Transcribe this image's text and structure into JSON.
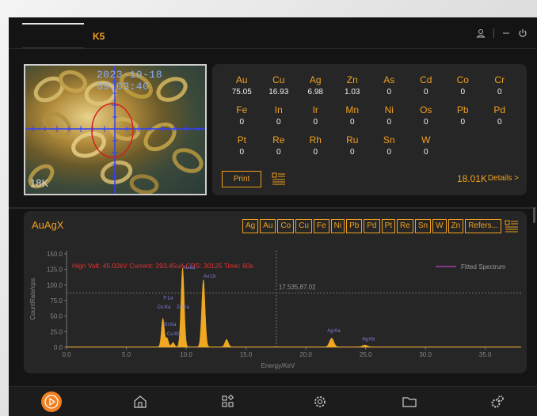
{
  "header": {
    "device_name": "K5",
    "icons": [
      "user-icon",
      "minimize-icon",
      "power-icon"
    ]
  },
  "camera": {
    "timestamp": "2023-10-18 09:03:40",
    "zoom_label": "18K"
  },
  "elements": [
    {
      "symbol": "Au",
      "value": "75.05"
    },
    {
      "symbol": "Cu",
      "value": "16.93"
    },
    {
      "symbol": "Ag",
      "value": "6.98"
    },
    {
      "symbol": "Zn",
      "value": "1.03"
    },
    {
      "symbol": "As",
      "value": "0"
    },
    {
      "symbol": "Cd",
      "value": "0"
    },
    {
      "symbol": "Co",
      "value": "0"
    },
    {
      "symbol": "Cr",
      "value": "0"
    },
    {
      "symbol": "Fe",
      "value": "0"
    },
    {
      "symbol": "In",
      "value": "0"
    },
    {
      "symbol": "Ir",
      "value": "0"
    },
    {
      "symbol": "Mn",
      "value": "0"
    },
    {
      "symbol": "Ni",
      "value": "0"
    },
    {
      "symbol": "Os",
      "value": "0"
    },
    {
      "symbol": "Pb",
      "value": "0"
    },
    {
      "symbol": "Pd",
      "value": "0"
    },
    {
      "symbol": "Pt",
      "value": "0"
    },
    {
      "symbol": "Re",
      "value": "0"
    },
    {
      "symbol": "Rh",
      "value": "0"
    },
    {
      "symbol": "Ru",
      "value": "0"
    },
    {
      "symbol": "Sn",
      "value": "0"
    },
    {
      "symbol": "W",
      "value": "0"
    }
  ],
  "results": {
    "print_label": "Print",
    "cps_value": "18.01K",
    "details_label": "Details >"
  },
  "spectrum": {
    "title": "AuAgX",
    "element_buttons": [
      "Ag",
      "Au",
      "Co",
      "Cu",
      "Fe",
      "Ni",
      "Pb",
      "Pd",
      "Pt",
      "Re",
      "Sn",
      "W",
      "Zn",
      "Refers..."
    ]
  },
  "chart_data": {
    "type": "area",
    "info_text": "High Volt: 45.02kV  Current: 293.45uA  CPS: 30125  Time: 60s",
    "legend": "Fitted Spectrum",
    "cursor_label": "17.535,87.02",
    "cursor": {
      "x": 17.535,
      "y": 87.02
    },
    "xlabel": "Energy/KeV",
    "ylabel": "CountRate/cps",
    "xlim": [
      0,
      38
    ],
    "ylim": [
      0,
      155
    ],
    "x_ticks": [
      "0.0",
      "5.0",
      "10.0",
      "15.0",
      "20.0",
      "25.0",
      "30.0",
      "35.0"
    ],
    "y_ticks": [
      "0.0",
      "25.0",
      "50.0",
      "75.0",
      "100.0",
      "125.0",
      "150.0"
    ],
    "peaks": [
      {
        "x": 8.05,
        "y": 46,
        "w": 0.12
      },
      {
        "x": 8.4,
        "y": 14,
        "w": 0.12
      },
      {
        "x": 8.9,
        "y": 7,
        "w": 0.12
      },
      {
        "x": 9.57,
        "y": 10,
        "w": 0.12
      },
      {
        "x": 9.71,
        "y": 122,
        "w": 0.13
      },
      {
        "x": 11.44,
        "y": 108,
        "w": 0.14
      },
      {
        "x": 13.38,
        "y": 12,
        "w": 0.14
      },
      {
        "x": 22.16,
        "y": 14,
        "w": 0.18
      },
      {
        "x": 24.94,
        "y": 3,
        "w": 0.2
      }
    ],
    "peak_labels": [
      {
        "text": "Au:La",
        "x": 9.71,
        "y": 126
      },
      {
        "text": "Au:Lb",
        "x": 11.44,
        "y": 112
      },
      {
        "text": "F:La",
        "x": 8.1,
        "y": 77
      },
      {
        "text": "Cu:Ka",
        "x": 7.6,
        "y": 62
      },
      {
        "text": "Zn:Ka",
        "x": 9.2,
        "y": 62
      },
      {
        "text": "Zn:Ka",
        "x": 8.1,
        "y": 34
      },
      {
        "text": "Cu:Kb",
        "x": 8.4,
        "y": 19
      },
      {
        "text": "Ag:Ka",
        "x": 21.8,
        "y": 24
      },
      {
        "text": "Ag:Kb",
        "x": 24.7,
        "y": 11
      }
    ],
    "colors": {
      "fill": "#f0a820",
      "info": "#e83030",
      "legend": "#c040c0",
      "label": "#8080e0"
    }
  }
}
